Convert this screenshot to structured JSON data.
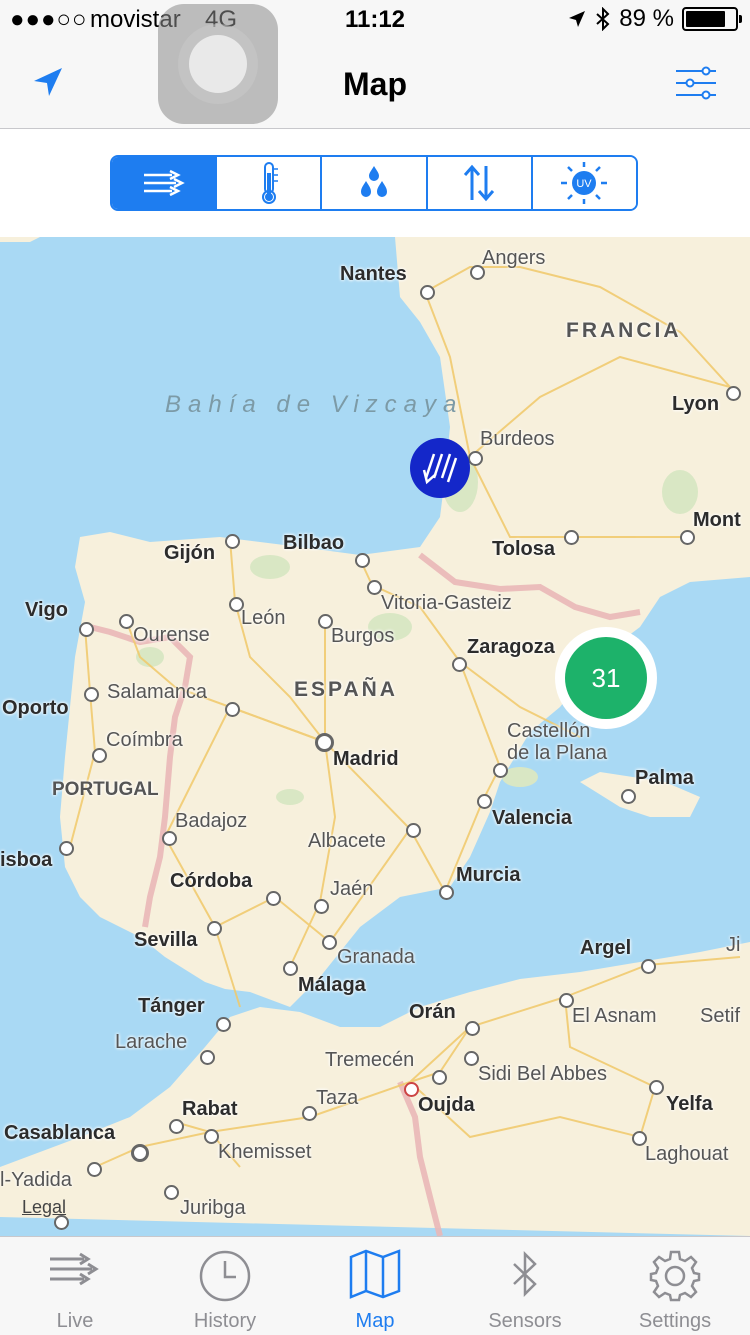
{
  "status_bar": {
    "signal": "●●●○○",
    "carrier": "movistar",
    "network": "4G",
    "time": "11:12",
    "battery_percent": "89 %",
    "battery_level": 0.89
  },
  "nav": {
    "title": "Map"
  },
  "segments": [
    {
      "icon": "wind-icon",
      "selected": true
    },
    {
      "icon": "thermometer-icon",
      "selected": false
    },
    {
      "icon": "humidity-drops-icon",
      "selected": false
    },
    {
      "icon": "pressure-arrows-icon",
      "selected": false
    },
    {
      "icon": "uv-sun-icon",
      "label": "UV",
      "selected": false
    }
  ],
  "map": {
    "sea_label": "Bahía de Vizcaya",
    "countries": [
      "FRANCIA",
      "ESPAÑA",
      "PORTUGAL"
    ],
    "cities": [
      "Nantes",
      "Angers",
      "Lyon",
      "Burdeos",
      "Mont",
      "Tolosa",
      "Gijón",
      "Bilbao",
      "Vigo",
      "León",
      "Vitoria-Gasteiz",
      "Ourense",
      "Burgos",
      "Zaragoza",
      "Salamanca",
      "Oporto",
      "Coímbra",
      "Madrid",
      "Castellón de la Plana",
      "Palma",
      "Badajoz",
      "Valencia",
      "isboa",
      "Albacete",
      "Córdoba",
      "Murcia",
      "Jaén",
      "Sevilla",
      "Granada",
      "Argel",
      "Ji",
      "Tánger",
      "Málaga",
      "Orán",
      "El Asnam",
      "Setif",
      "Larache",
      "Tremecén",
      "Sidi Bel Abbes",
      "Taza",
      "Rabat",
      "Oujda",
      "Yelfa",
      "Casablanca",
      "Khemisset",
      "Laghouat",
      "l-Yadida",
      "Juribga"
    ],
    "cluster_count": "31",
    "legal": "Legal"
  },
  "tabs": [
    {
      "label": "Live",
      "icon": "wind-icon",
      "active": false
    },
    {
      "label": "History",
      "icon": "clock-icon",
      "active": false
    },
    {
      "label": "Map",
      "icon": "map-icon",
      "active": true
    },
    {
      "label": "Sensors",
      "icon": "bluetooth-icon",
      "active": false
    },
    {
      "label": "Settings",
      "icon": "gear-icon",
      "active": false
    }
  ],
  "colors": {
    "accent": "#1e7df0",
    "station_pin": "#1427c9",
    "cluster": "#1db26a",
    "sea": "#a9d9f4",
    "land": "#f7f0dc"
  }
}
